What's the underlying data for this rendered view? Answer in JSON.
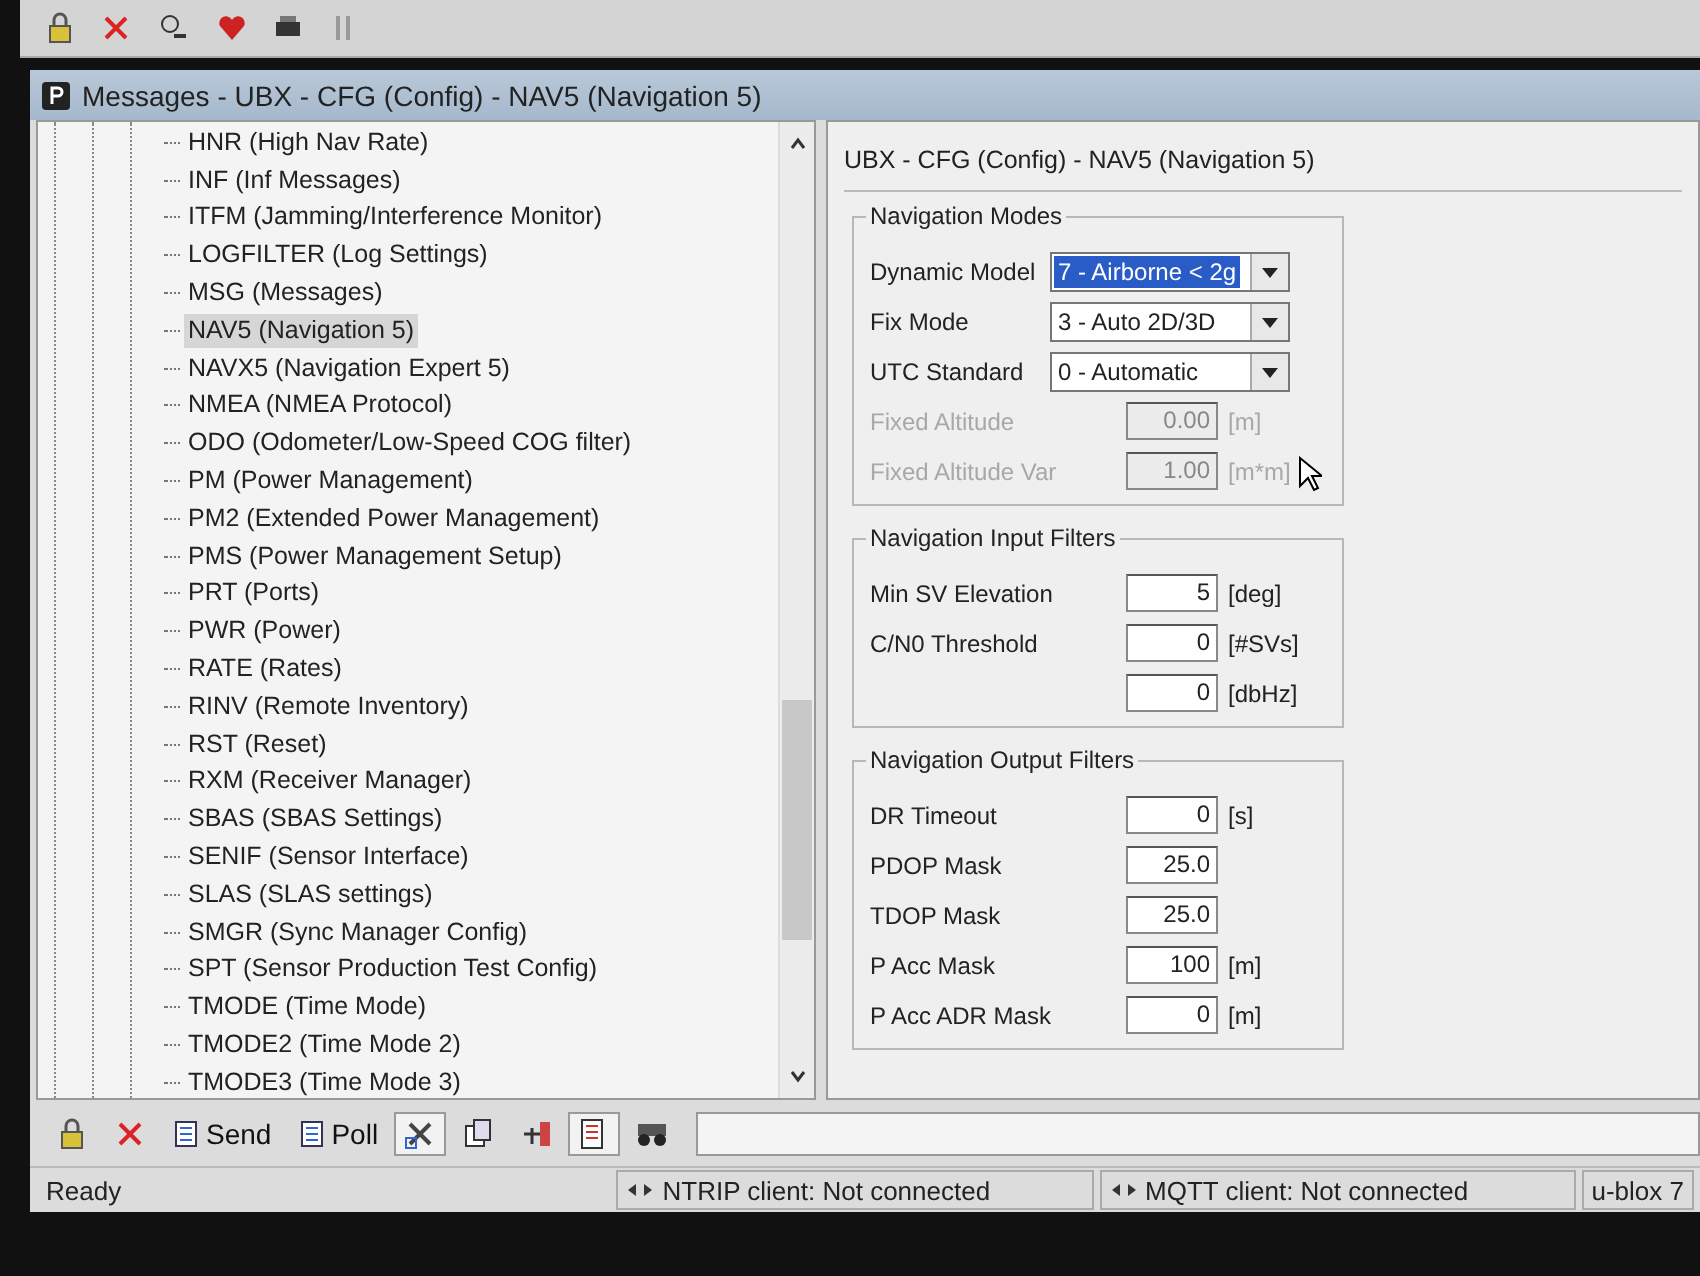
{
  "window": {
    "title": "Messages - UBX - CFG (Config) - NAV5 (Navigation 5)"
  },
  "tree": {
    "items": [
      {
        "label": "HNR (High Nav Rate)",
        "selected": false
      },
      {
        "label": "INF (Inf Messages)",
        "selected": false
      },
      {
        "label": "ITFM (Jamming/Interference Monitor)",
        "selected": false
      },
      {
        "label": "LOGFILTER (Log Settings)",
        "selected": false
      },
      {
        "label": "MSG (Messages)",
        "selected": false
      },
      {
        "label": "NAV5 (Navigation 5)",
        "selected": true
      },
      {
        "label": "NAVX5 (Navigation Expert 5)",
        "selected": false
      },
      {
        "label": "NMEA (NMEA Protocol)",
        "selected": false
      },
      {
        "label": "ODO (Odometer/Low-Speed COG filter)",
        "selected": false
      },
      {
        "label": "PM (Power Management)",
        "selected": false
      },
      {
        "label": "PM2 (Extended Power Management)",
        "selected": false
      },
      {
        "label": "PMS (Power Management Setup)",
        "selected": false
      },
      {
        "label": "PRT (Ports)",
        "selected": false
      },
      {
        "label": "PWR (Power)",
        "selected": false
      },
      {
        "label": "RATE (Rates)",
        "selected": false
      },
      {
        "label": "RINV (Remote Inventory)",
        "selected": false
      },
      {
        "label": "RST (Reset)",
        "selected": false
      },
      {
        "label": "RXM (Receiver Manager)",
        "selected": false
      },
      {
        "label": "SBAS (SBAS Settings)",
        "selected": false
      },
      {
        "label": "SENIF (Sensor Interface)",
        "selected": false
      },
      {
        "label": "SLAS (SLAS settings)",
        "selected": false
      },
      {
        "label": "SMGR (Sync Manager Config)",
        "selected": false
      },
      {
        "label": "SPT (Sensor Production Test Config)",
        "selected": false
      },
      {
        "label": "TMODE (Time Mode)",
        "selected": false
      },
      {
        "label": "TMODE2 (Time Mode 2)",
        "selected": false
      },
      {
        "label": "TMODE3 (Time Mode 3)",
        "selected": false
      }
    ]
  },
  "panel": {
    "title": "UBX - CFG (Config) - NAV5 (Navigation 5)",
    "groups": [
      {
        "title": "Navigation Modes",
        "fields": [
          {
            "kind": "dropdown",
            "label": "Dynamic Model",
            "value": "7 - Airborne < 2g",
            "focused": true
          },
          {
            "kind": "dropdown",
            "label": "Fix Mode",
            "value": "3 - Auto 2D/3D",
            "focused": false
          },
          {
            "kind": "dropdown",
            "label": "UTC Standard",
            "value": "0 - Automatic",
            "focused": false
          },
          {
            "kind": "number",
            "label": "Fixed Altitude",
            "value": "0.00",
            "unit": "[m]",
            "disabled": true
          },
          {
            "kind": "number",
            "label": "Fixed Altitude Var",
            "value": "1.00",
            "unit": "[m*m]",
            "disabled": true
          }
        ]
      },
      {
        "title": "Navigation Input Filters",
        "fields": [
          {
            "kind": "number",
            "label": "Min SV Elevation",
            "value": "5",
            "unit": "[deg]",
            "disabled": false
          },
          {
            "kind": "number",
            "label": "C/N0 Threshold",
            "value": "0",
            "unit": "[#SVs]",
            "disabled": false
          },
          {
            "kind": "number",
            "value": "0",
            "unit": "[dbHz]",
            "disabled": false
          }
        ]
      },
      {
        "title": "Navigation Output Filters",
        "fields": [
          {
            "kind": "number",
            "label": "DR Timeout",
            "value": "0",
            "unit": "[s]",
            "disabled": false
          },
          {
            "kind": "number",
            "label": "PDOP Mask",
            "value": "25.0",
            "disabled": false
          },
          {
            "kind": "number",
            "label": "TDOP Mask",
            "value": "25.0",
            "disabled": false
          },
          {
            "kind": "number",
            "label": "P Acc Mask",
            "value": "100",
            "unit": "[m]",
            "disabled": false
          },
          {
            "kind": "number",
            "label": "P Acc ADR Mask",
            "value": "0",
            "unit": "[m]",
            "disabled": false
          }
        ]
      }
    ]
  },
  "bottom_toolbar": [
    {
      "kind": "icon",
      "pressed": false
    },
    {
      "kind": "icon",
      "pressed": false
    },
    {
      "kind": "text",
      "label": "Send",
      "pressed": false
    },
    {
      "kind": "text",
      "label": "Poll",
      "pressed": false
    },
    {
      "kind": "icon",
      "pressed": true
    },
    {
      "kind": "icon",
      "pressed": false
    },
    {
      "kind": "icon",
      "pressed": false
    },
    {
      "kind": "icon",
      "pressed": true
    },
    {
      "kind": "icon",
      "pressed": false
    }
  ],
  "status_bar": {
    "text": "Ready",
    "ntrip": "NTRIP client: Not connected",
    "mqtt": "MQTT client: Not connected",
    "device": "u-blox 7"
  }
}
